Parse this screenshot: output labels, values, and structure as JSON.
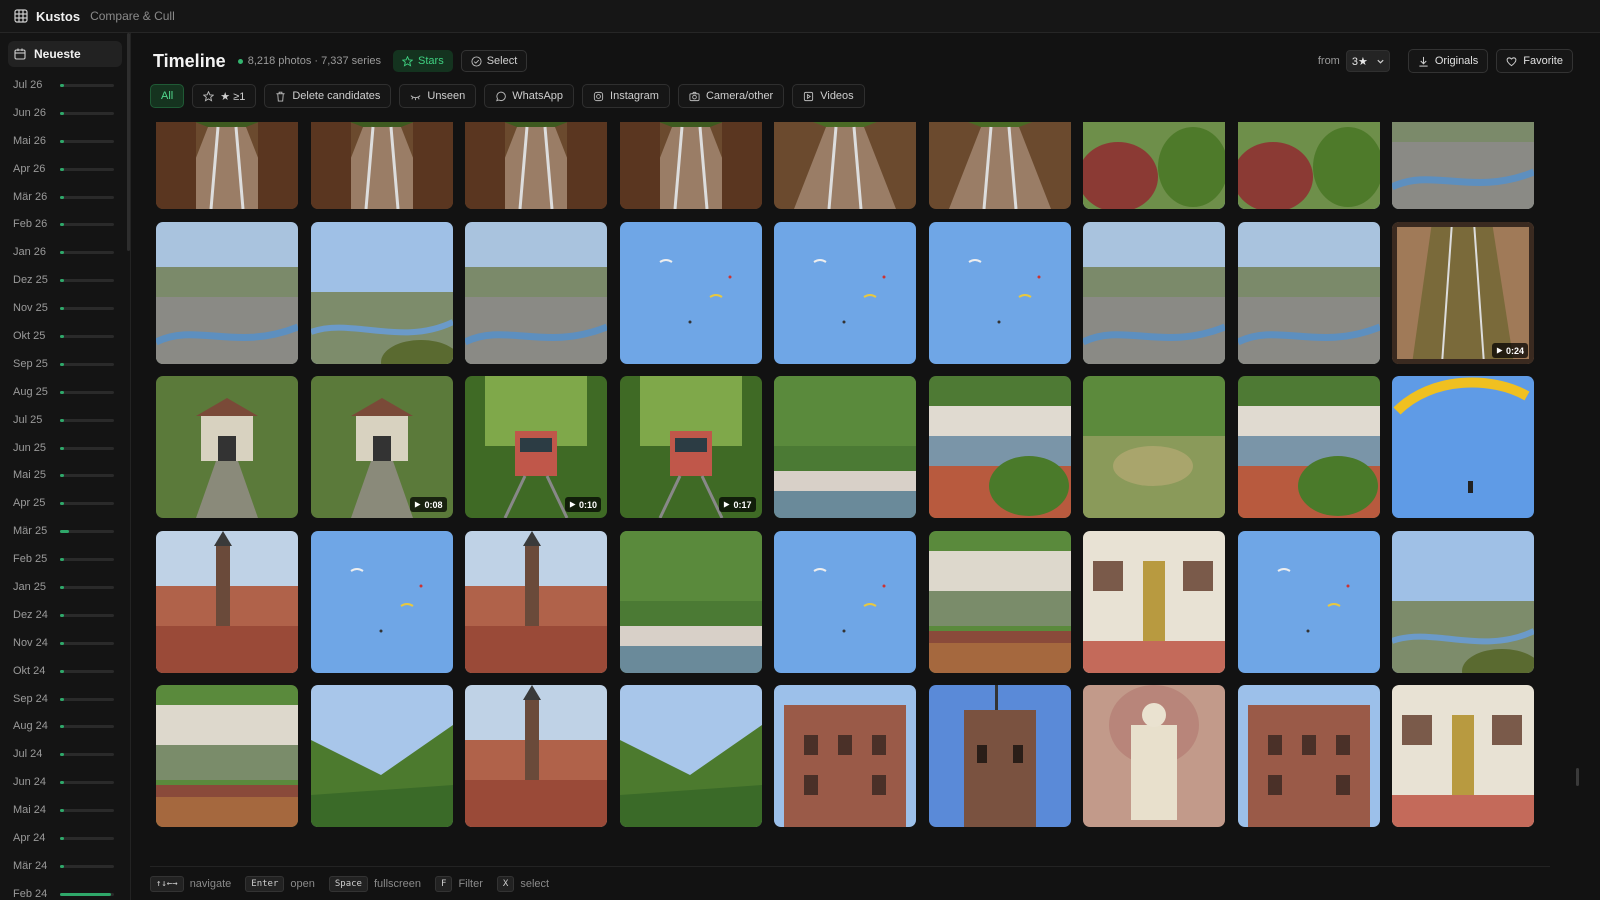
{
  "app": {
    "name": "Kustos",
    "subtitle": "Compare & Cull"
  },
  "sidebar": {
    "newest_label": "Neueste",
    "months": [
      {
        "label": "Jul 26",
        "level": 0.05
      },
      {
        "label": "Jun 26",
        "level": 0.05
      },
      {
        "label": "Mai 26",
        "level": 0.05
      },
      {
        "label": "Apr 26",
        "level": 0.08
      },
      {
        "label": "Mär 26",
        "level": 0.06
      },
      {
        "label": "Feb 26",
        "level": 0.06
      },
      {
        "label": "Jan 26",
        "level": 0.05
      },
      {
        "label": "Dez 25",
        "level": 0.05
      },
      {
        "label": "Nov 25",
        "level": 0.05
      },
      {
        "label": "Okt 25",
        "level": 0.05
      },
      {
        "label": "Sep 25",
        "level": 0.05
      },
      {
        "label": "Aug 25",
        "level": 0.06
      },
      {
        "label": "Jul 25",
        "level": 0.05
      },
      {
        "label": "Jun 25",
        "level": 0.05
      },
      {
        "label": "Mai 25",
        "level": 0.05
      },
      {
        "label": "Apr 25",
        "level": 0.05
      },
      {
        "label": "Mär 25",
        "level": 0.17
      },
      {
        "label": "Feb 25",
        "level": 0.06
      },
      {
        "label": "Jan 25",
        "level": 0.05
      },
      {
        "label": "Dez 24",
        "level": 0.06
      },
      {
        "label": "Nov 24",
        "level": 0.05
      },
      {
        "label": "Okt 24",
        "level": 0.05
      },
      {
        "label": "Sep 24",
        "level": 0.05
      },
      {
        "label": "Aug 24",
        "level": 0.05
      },
      {
        "label": "Jul 24",
        "level": 0.05
      },
      {
        "label": "Jun 24",
        "level": 0.05
      },
      {
        "label": "Mai 24",
        "level": 0.08
      },
      {
        "label": "Apr 24",
        "level": 0.05
      },
      {
        "label": "Mär 24",
        "level": 0.05
      },
      {
        "label": "Feb 24",
        "level": 0.95
      }
    ]
  },
  "header": {
    "title": "Timeline",
    "stats": "8,218 photos · 7,337 series",
    "stars_label": "Stars",
    "select_label": "Select",
    "from_label": "from",
    "from_value": "3★",
    "originals_label": "Originals",
    "favorite_label": "Favorite"
  },
  "filters": [
    {
      "label": "All",
      "icon": "none",
      "active": true
    },
    {
      "label": "★ ≥1",
      "icon": "star-icon",
      "active": false
    },
    {
      "label": "Delete candidates",
      "icon": "trash-icon",
      "active": false
    },
    {
      "label": "Unseen",
      "icon": "eye-off-icon",
      "active": false
    },
    {
      "label": "WhatsApp",
      "icon": "whatsapp-icon",
      "active": false
    },
    {
      "label": "Instagram",
      "icon": "instagram-icon",
      "active": false
    },
    {
      "label": "Camera/other",
      "icon": "camera-icon",
      "active": false
    },
    {
      "label": "Videos",
      "icon": "video-icon",
      "active": false
    }
  ],
  "photos": [
    {
      "kind": "funicular",
      "duration": ""
    },
    {
      "kind": "funicular",
      "duration": ""
    },
    {
      "kind": "funicular",
      "duration": ""
    },
    {
      "kind": "funicular",
      "duration": ""
    },
    {
      "kind": "funicular-car",
      "duration": ""
    },
    {
      "kind": "funicular-car",
      "duration": ""
    },
    {
      "kind": "hill-bush",
      "duration": ""
    },
    {
      "kind": "hill-bush",
      "duration": ""
    },
    {
      "kind": "aerial-city",
      "duration": ""
    },
    {
      "kind": "aerial-city",
      "duration": ""
    },
    {
      "kind": "aerial-valley",
      "duration": ""
    },
    {
      "kind": "aerial-city",
      "duration": ""
    },
    {
      "kind": "sky-paragliders",
      "duration": ""
    },
    {
      "kind": "sky-paragliders",
      "duration": ""
    },
    {
      "kind": "sky-paragliders",
      "duration": ""
    },
    {
      "kind": "aerial-city",
      "duration": ""
    },
    {
      "kind": "aerial-city",
      "duration": ""
    },
    {
      "kind": "track-stone",
      "duration": "0:24"
    },
    {
      "kind": "station",
      "duration": ""
    },
    {
      "kind": "station",
      "duration": "0:08"
    },
    {
      "kind": "tram-forest",
      "duration": "0:10"
    },
    {
      "kind": "tram-forest",
      "duration": "0:17"
    },
    {
      "kind": "forest-river",
      "duration": ""
    },
    {
      "kind": "river-town",
      "duration": ""
    },
    {
      "kind": "forest-hill",
      "duration": ""
    },
    {
      "kind": "river-town",
      "duration": ""
    },
    {
      "kind": "sky-single",
      "duration": ""
    },
    {
      "kind": "church-town",
      "duration": ""
    },
    {
      "kind": "sky-paragliders",
      "duration": ""
    },
    {
      "kind": "church-town",
      "duration": ""
    },
    {
      "kind": "forest-river",
      "duration": ""
    },
    {
      "kind": "sky-paragliders",
      "duration": ""
    },
    {
      "kind": "river-bridge",
      "duration": ""
    },
    {
      "kind": "facade-statue",
      "duration": ""
    },
    {
      "kind": "sky-paragliders",
      "duration": ""
    },
    {
      "kind": "aerial-valley",
      "duration": ""
    },
    {
      "kind": "river-bridge",
      "duration": ""
    },
    {
      "kind": "green-hills",
      "duration": ""
    },
    {
      "kind": "church-town",
      "duration": ""
    },
    {
      "kind": "green-hills",
      "duration": ""
    },
    {
      "kind": "castle",
      "duration": ""
    },
    {
      "kind": "castle-tower",
      "duration": ""
    },
    {
      "kind": "statue-stone",
      "duration": ""
    },
    {
      "kind": "castle",
      "duration": ""
    },
    {
      "kind": "facade-statue",
      "duration": ""
    }
  ],
  "footer": {
    "hints": [
      {
        "key": "↑↓←→",
        "label": "navigate"
      },
      {
        "key": "Enter",
        "label": "open"
      },
      {
        "key": "Space",
        "label": "fullscreen"
      },
      {
        "key": "F",
        "label": "Filter"
      },
      {
        "key": "X",
        "label": "select"
      }
    ]
  },
  "colors": {
    "accent": "#33b56f",
    "background": "#121212"
  }
}
